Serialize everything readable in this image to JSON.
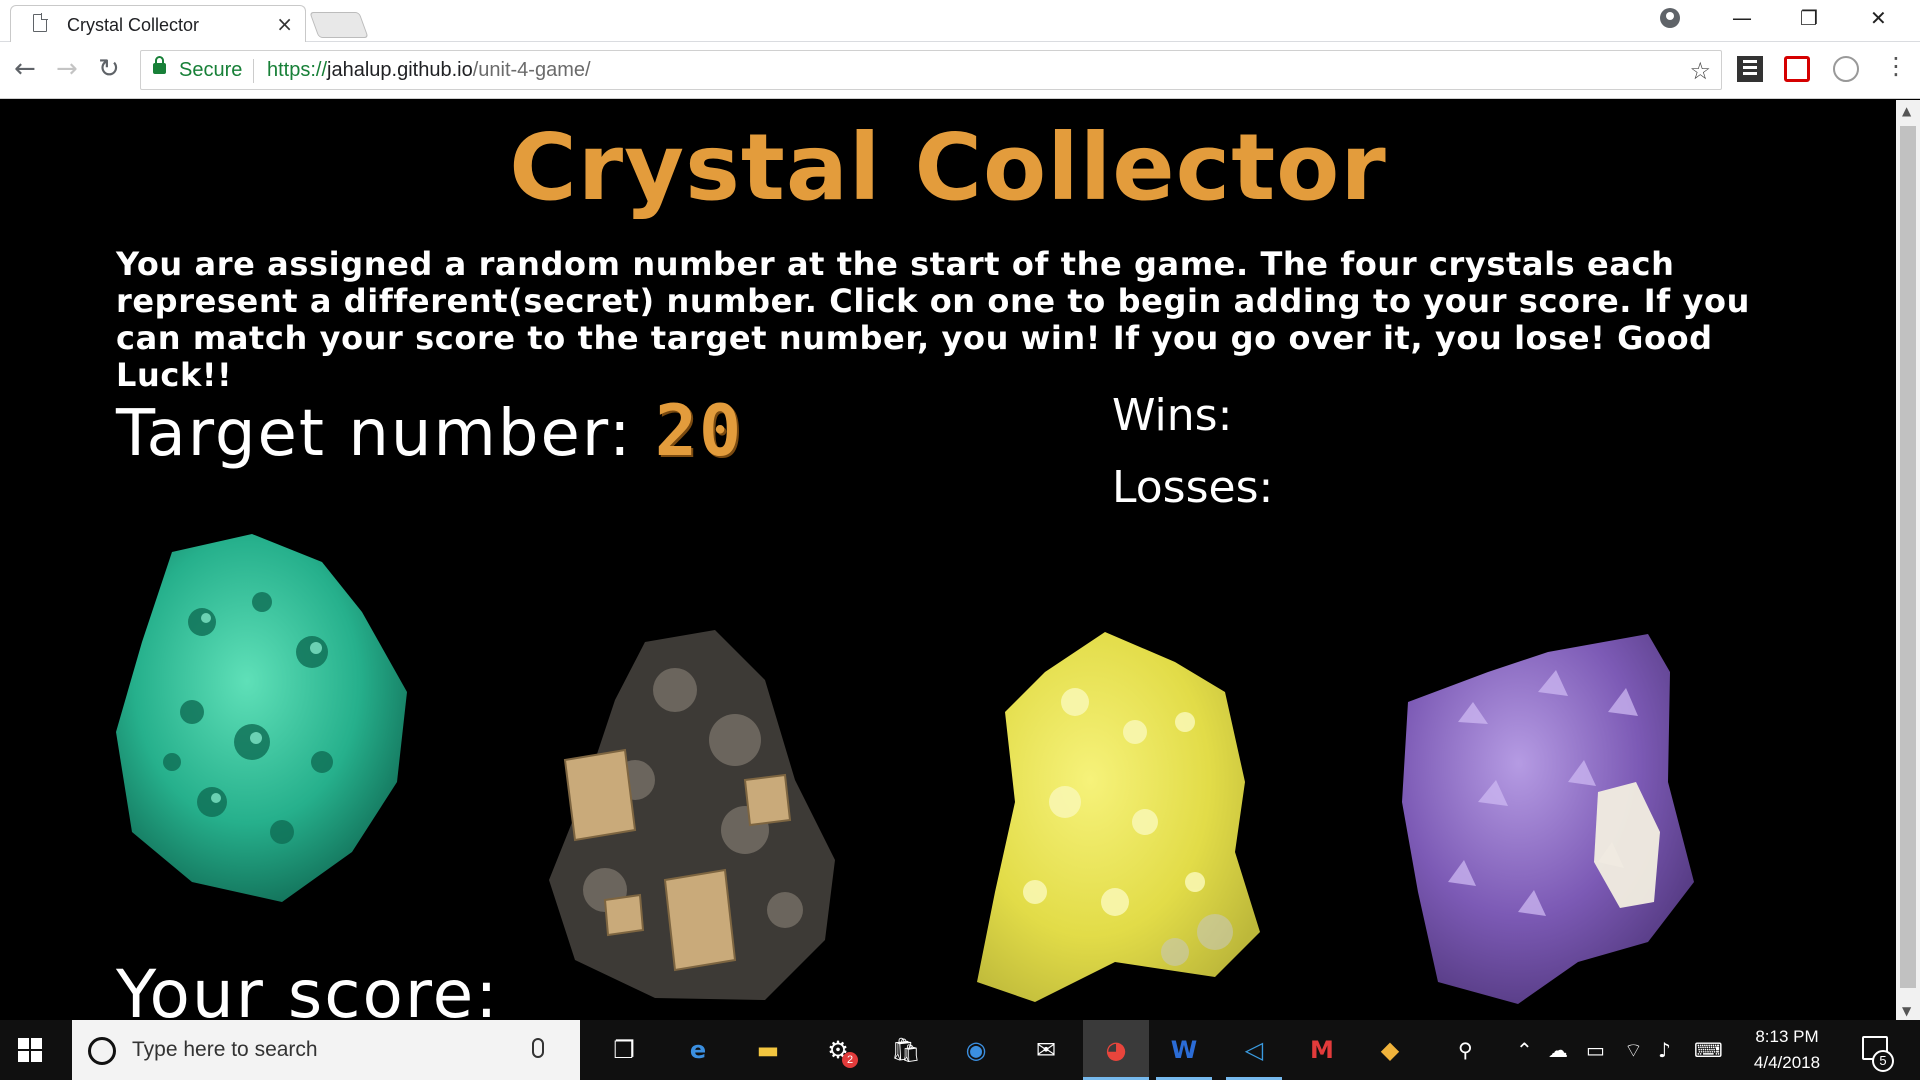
{
  "browser": {
    "tab_title": "Crystal Collector",
    "tab_close": "×",
    "window_controls": {
      "minimize": "—",
      "restore": "❐",
      "close": "✕"
    },
    "nav": {
      "back": "←",
      "forward": "→",
      "reload": "↻"
    },
    "secure_label": "Secure",
    "url": {
      "scheme": "https://",
      "host": "jahalup.github.io",
      "path": "/unit-4-game/"
    },
    "star": "☆",
    "menu": "⋮"
  },
  "game": {
    "title": "Crystal Collector",
    "instructions": "You are assigned a random number at the start of the game. The four crystals each represent a different(secret) number. Click on one to begin adding to your score. If you can match your score to the target number, you win! If you go over it, you lose! Good Luck!!",
    "target_label": "Target number: ",
    "target_value": "20",
    "wins_label": "Wins:",
    "losses_label": "Losses:",
    "score_label": "Your score:",
    "crystals": [
      {
        "name": "malachite",
        "color": "#2fbf96"
      },
      {
        "name": "pyrite",
        "color": "#5a5550"
      },
      {
        "name": "sulfur",
        "color": "#e6e04a"
      },
      {
        "name": "amethyst",
        "color": "#8e6fc0"
      }
    ],
    "accent_color": "#e39c3c"
  },
  "taskbar": {
    "search_placeholder": "Type here to search",
    "time": "8:13 PM",
    "date": "4/4/2018",
    "notification_count": "5",
    "badge_count": "2",
    "icons": [
      "task-view-icon",
      "edge-icon",
      "file-explorer-icon",
      "game-icon",
      "store-icon",
      "app-icon",
      "mail-icon",
      "chrome-icon",
      "word-icon",
      "vscode-icon",
      "gmail-icon",
      "git-icon"
    ]
  }
}
